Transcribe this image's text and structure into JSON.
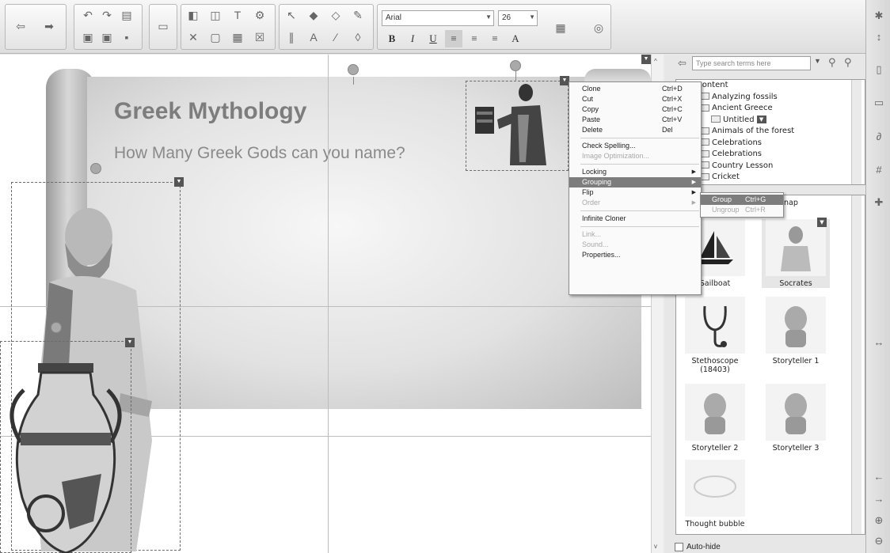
{
  "toolbar": {
    "font_name": "Arial",
    "font_size": "26",
    "format_buttons": [
      "B",
      "I",
      "U"
    ]
  },
  "canvas": {
    "title": "Greek Mythology",
    "subtitle": "How Many Greek Gods can you name?"
  },
  "context_menu": {
    "items": [
      {
        "label": "Clone",
        "shortcut": "Ctrl+D"
      },
      {
        "label": "Cut",
        "shortcut": "Ctrl+X"
      },
      {
        "label": "Copy",
        "shortcut": "Ctrl+C"
      },
      {
        "label": "Paste",
        "shortcut": "Ctrl+V"
      },
      {
        "label": "Delete",
        "shortcut": "Del"
      },
      {
        "label": "Check Spelling..."
      },
      {
        "label": "Image Optimization..."
      },
      {
        "label": "Locking"
      },
      {
        "label": "Grouping"
      },
      {
        "label": "Flip"
      },
      {
        "label": "Order"
      },
      {
        "label": "Infinite Cloner"
      },
      {
        "label": "Link..."
      },
      {
        "label": "Sound..."
      },
      {
        "label": "Properties..."
      }
    ],
    "submenu": [
      {
        "label": "Group",
        "shortcut": "Ctrl+G"
      },
      {
        "label": "Ungroup",
        "shortcut": "Ctrl+R"
      }
    ]
  },
  "panel": {
    "search_placeholder": "Type search terms here",
    "tree": [
      "My Content",
      "Analyzing fossils",
      "Ancient Greece",
      "Untitled",
      "Animals of the forest",
      "Celebrations",
      "Celebrations",
      "Country Lesson",
      "Cricket"
    ],
    "library_partial_label": "nap",
    "library": [
      "Sailboat",
      "Socrates",
      "Stethoscope (18403)",
      "Storyteller 1",
      "Storyteller 2",
      "Storyteller 3",
      "Thought bubble"
    ],
    "autohide_label": "Auto-hide"
  },
  "colors": {
    "title": "#7d7d7d",
    "menu_highlight": "#7d7d7d"
  },
  "icons": [
    "back-arrow-icon",
    "forward-arrow-icon",
    "undo-icon",
    "redo-icon",
    "select-arrow-icon",
    "eraser-icon",
    "pen-icon",
    "line-icon",
    "table-icon",
    "search-icon",
    "settings-icon",
    "link-icon",
    "puzzle-icon"
  ]
}
